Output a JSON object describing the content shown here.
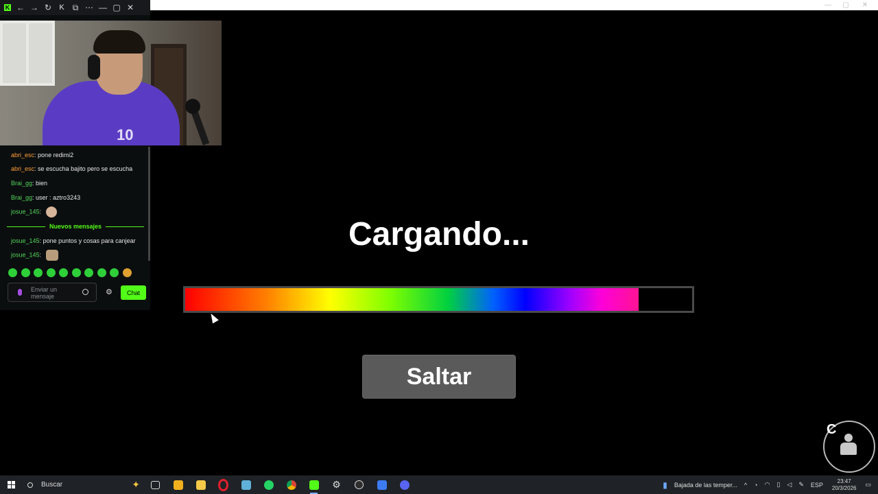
{
  "kick_window": {
    "title": "K",
    "logo_letter": "K",
    "chat": {
      "messages": [
        {
          "user": "abri_esc",
          "text": "pone redimi2"
        },
        {
          "user": "abri_esc",
          "text": "se escucha bajito pero se escucha"
        },
        {
          "user": "Brai_gg",
          "text": "bien"
        },
        {
          "user": "Brai_gg",
          "text": "user : aztro3243"
        },
        {
          "user": "josue_145",
          "text": ""
        },
        {
          "user": "josue_145",
          "text": "pone puntos y cosas para canjear"
        },
        {
          "user": "josue_145",
          "text": ""
        }
      ],
      "new_messages_label": "Nuevos mensajes",
      "input_placeholder": "Enviar un mensaje",
      "send_button": "Chat"
    },
    "video": {
      "jersey_number": "10"
    }
  },
  "loader": {
    "title": "Cargando...",
    "progress": 0.895,
    "skip_button": "Saltar"
  },
  "corner_badge": {
    "letter": "C"
  },
  "taskbar": {
    "search_placeholder": "Buscar",
    "weather_text": "Bajada de las temper...",
    "language": "ESP",
    "time": "23:47",
    "date": "20/3/2026"
  },
  "colors": {
    "kick_green": "#53fc18",
    "username_orange": "#ff9f3a",
    "username_green": "#53d45b",
    "skip_button_bg": "#5a5a5a"
  },
  "icons": [
    "kick-logo",
    "back-arrow",
    "forward-arrow",
    "reload-icon",
    "windows-logo",
    "search-icon",
    "task-view-icon",
    "store-icon",
    "file-explorer-icon",
    "opera-icon",
    "notepad-icon",
    "whatsapp-icon",
    "chrome-icon",
    "kick-icon",
    "settings-icon",
    "clock-app-icon",
    "roblox-icon",
    "discord-icon"
  ]
}
